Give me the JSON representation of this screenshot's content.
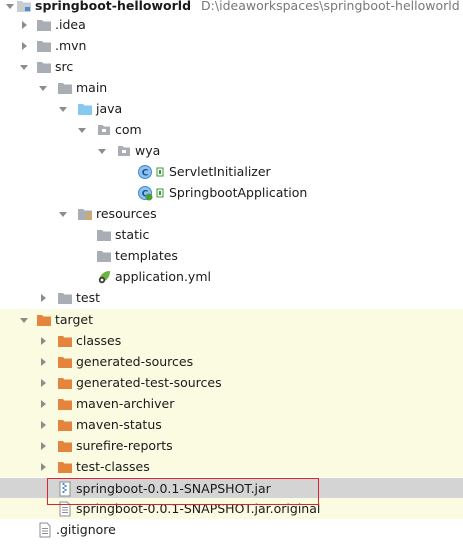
{
  "project": {
    "name": "springboot-helloworld",
    "path": "D:\\ideaworkspaces\\springboot-helloworld"
  },
  "tree": {
    "idea": ".idea",
    "mvn": ".mvn",
    "src": "src",
    "main": "main",
    "java": "java",
    "com": "com",
    "wya": "wya",
    "servlet_initializer": "ServletInitializer",
    "springboot_application": "SpringbootApplication",
    "resources": "resources",
    "static": "static",
    "templates": "templates",
    "application_yml": "application.yml",
    "test": "test",
    "target": "target",
    "classes": "classes",
    "generated_sources": "generated-sources",
    "generated_test_sources": "generated-test-sources",
    "maven_archiver": "maven-archiver",
    "maven_status": "maven-status",
    "surefire_reports": "surefire-reports",
    "test_classes": "test-classes",
    "jar": "springboot-0.0.1-SNAPSHOT.jar",
    "jar_original": "springboot-0.0.1-SNAPSHOT.jar.original",
    "gitignore": ".gitignore"
  },
  "colors": {
    "folder": "#c9cdd2",
    "folder_orange": "#e5843c",
    "java_folder": "#87c9ee",
    "class_icon": "#3e8ad6",
    "highlight_border": "#d9232e",
    "selected_row": "#d4d4d4",
    "excluded_row": "#fbfbe1"
  }
}
